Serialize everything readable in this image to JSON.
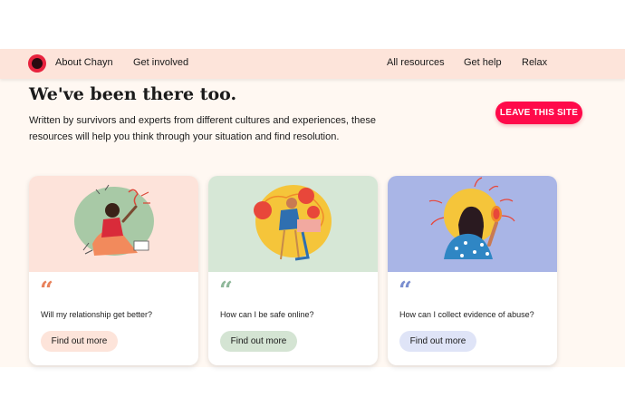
{
  "nav": {
    "left_links": [
      "About Chayn",
      "Get involved"
    ],
    "right_links": [
      "All resources",
      "Get help",
      "Relax"
    ]
  },
  "hero": {
    "title": "We've been there too.",
    "intro": "Written by survivors and experts from different cultures and experiences, these resources will help you think through your situation and find resolution.",
    "leave_button": "LEAVE THIS SITE"
  },
  "cards": [
    {
      "question": "Will my relationship get better?",
      "button": "Find out more",
      "quote": "“",
      "accent": "#e8825c",
      "button_bg": "#fde4da",
      "illus_bg": "#fde3da"
    },
    {
      "question": "How can I be safe online?",
      "button": "Find out more",
      "quote": "“",
      "accent": "#8fb89a",
      "button_bg": "#d4e4d3",
      "illus_bg": "#d6e7d6"
    },
    {
      "question": "How can I collect evidence of abuse?",
      "button": "Find out more",
      "quote": "“",
      "accent": "#7b8fd0",
      "button_bg": "#dfe4f7",
      "illus_bg": "#a9b5e6"
    }
  ],
  "colors": {
    "brand_red": "#ff0a4a",
    "nav_bg": "#fde4da",
    "page_bg": "#fff8f2"
  },
  "icons": {
    "logo": "chayn-logo-icon",
    "quote": "quote-icon"
  }
}
